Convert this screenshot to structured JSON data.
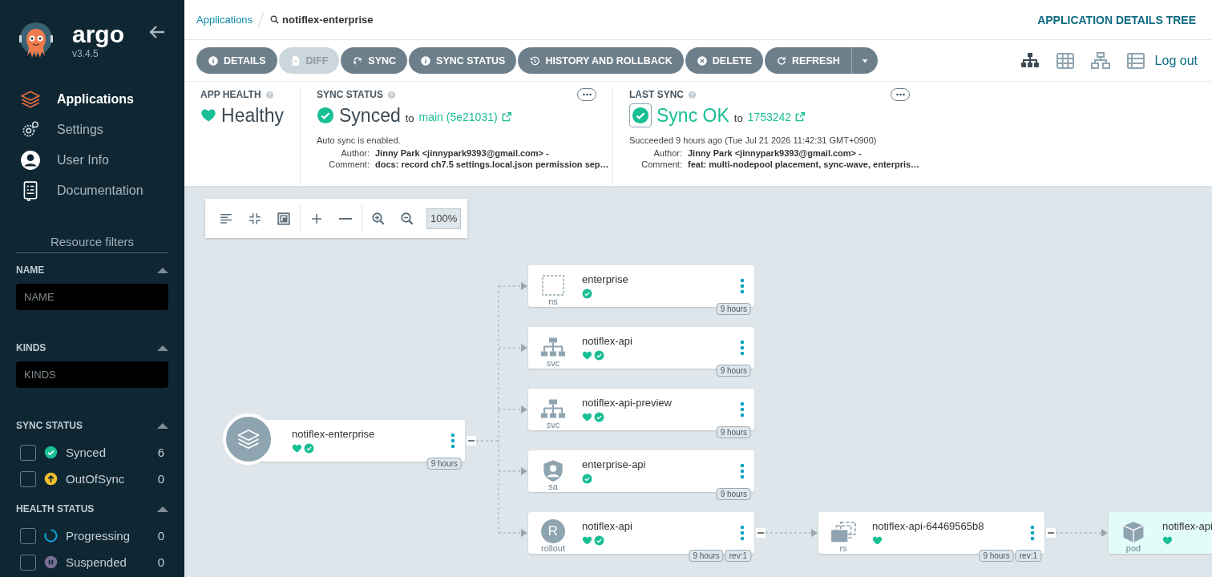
{
  "sidebar": {
    "logo_text": "argo",
    "version": "v3.4.5",
    "nav": [
      {
        "label": "Applications",
        "selected": true
      },
      {
        "label": "Settings",
        "selected": false
      },
      {
        "label": "User Info",
        "selected": false
      },
      {
        "label": "Documentation",
        "selected": false
      }
    ],
    "filters_title": "Resource filters",
    "filters": [
      {
        "kind": "input",
        "title": "NAME",
        "placeholder": "NAME"
      },
      {
        "kind": "input",
        "title": "KINDS",
        "placeholder": "KINDS"
      },
      {
        "kind": "checklist",
        "title": "SYNC STATUS",
        "items": [
          {
            "label": "Synced",
            "count": "6",
            "kind": "synced",
            "checked": false
          },
          {
            "label": "OutOfSync",
            "count": "0",
            "kind": "outofsync",
            "checked": false
          }
        ]
      },
      {
        "kind": "checklist",
        "title": "HEALTH STATUS",
        "items": [
          {
            "label": "Progressing",
            "count": "0",
            "kind": "progressing",
            "checked": false
          },
          {
            "label": "Suspended",
            "count": "0",
            "kind": "suspended",
            "checked": false
          }
        ]
      }
    ]
  },
  "breadcrumb": {
    "link": "Applications",
    "current": "notiflex-enterprise"
  },
  "page_title": "APPLICATION DETAILS TREE",
  "actions": [
    {
      "label": "DETAILS",
      "disabled": false
    },
    {
      "label": "DIFF",
      "disabled": true
    },
    {
      "label": "SYNC",
      "disabled": false
    },
    {
      "label": "SYNC STATUS",
      "disabled": false
    },
    {
      "label": "HISTORY AND ROLLBACK",
      "disabled": false
    },
    {
      "label": "DELETE",
      "disabled": false
    },
    {
      "label": "REFRESH",
      "disabled": false,
      "dropdown": true
    }
  ],
  "views": [
    {
      "selected": true
    },
    {
      "selected": false
    },
    {
      "selected": false
    },
    {
      "selected": false
    }
  ],
  "logout": "Log out",
  "app_health": {
    "title": "APP HEALTH",
    "status": "Healthy"
  },
  "sync_status": {
    "title": "SYNC STATUS",
    "status": "Synced",
    "to": "to",
    "revision": "main (5e21031)",
    "note": "Auto sync is enabled.",
    "fields": [
      {
        "label": "Author:",
        "value": "Jinny Park <jinnypark9393@gmail.com> -"
      },
      {
        "label": "Comment:",
        "value": "docs: record ch7.5 settings.local.json permission sep…"
      }
    ]
  },
  "last_sync": {
    "title": "LAST SYNC",
    "status": "Sync OK",
    "to": "to",
    "revision": "1753242",
    "note": "Succeeded 9 hours ago (Tue Jul 21 2026 11:42:31 GMT+0900)",
    "fields": [
      {
        "label": "Author:",
        "value": "Jinny Park <jinnypark9393@gmail.com> -"
      },
      {
        "label": "Comment:",
        "value": "feat: multi-nodepool placement, sync-wave, enterpris…"
      }
    ]
  },
  "graph_toolbar": {
    "zoom": "100%"
  },
  "tree": {
    "name": "notiflex-enterprise",
    "kind": "app",
    "healthy": true,
    "synced": true,
    "age": "9 hours",
    "expanded": true,
    "selected": false,
    "children": [
      {
        "name": "enterprise",
        "kind_label": "ns",
        "kind": "ns",
        "healthy": false,
        "synced": true,
        "age": "9 hours",
        "selected": false
      },
      {
        "name": "notiflex-api",
        "kind_label": "svc",
        "kind": "svc",
        "healthy": true,
        "synced": true,
        "age": "9 hours",
        "selected": false
      },
      {
        "name": "notiflex-api-preview",
        "kind_label": "svc",
        "kind": "svc",
        "healthy": true,
        "synced": true,
        "age": "9 hours",
        "selected": false
      },
      {
        "name": "enterprise-api",
        "kind_label": "sa",
        "kind": "sa",
        "healthy": false,
        "synced": true,
        "age": "9 hours",
        "selected": false
      },
      {
        "name": "notiflex-api",
        "kind_label": "rollout",
        "kind": "rollout",
        "icon_text": "R",
        "healthy": true,
        "synced": true,
        "age": "9 hours",
        "rev": "rev:1",
        "expanded": true,
        "selected": false,
        "children": [
          {
            "name": "notiflex-api-64469565b8",
            "kind_label": "rs",
            "kind": "rs",
            "healthy": true,
            "synced": false,
            "age": "9 hours",
            "rev": "rev:1",
            "expanded": true,
            "selected": false,
            "children": [
              {
                "name": "notiflex-api",
                "kind_label": "pod",
                "kind": "pod",
                "healthy": true,
                "synced": false,
                "selected": true
              }
            ]
          }
        ]
      }
    ]
  }
}
